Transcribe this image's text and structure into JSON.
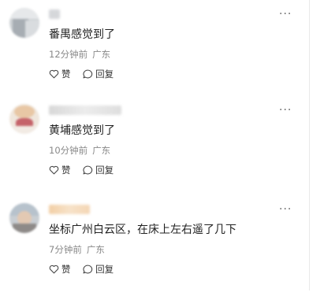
{
  "comments": [
    {
      "text": "番禺感觉到了",
      "time": "12分钟前",
      "location": "广东",
      "like_label": "赞",
      "reply_label": "回复",
      "more": "···"
    },
    {
      "text": "黄埔感觉到了",
      "time": "10分钟前",
      "location": "广东",
      "like_label": "赞",
      "reply_label": "回复",
      "more": "···"
    },
    {
      "text": "坐标广州白云区，在床上左右遥了几下",
      "time": "7分钟前",
      "location": "广东",
      "like_label": "赞",
      "reply_label": "回复",
      "more": "···"
    }
  ],
  "colors": {
    "text": "#222222",
    "meta": "#888888",
    "divider": "#e9e9e9"
  },
  "icons": [
    "heart-icon",
    "comment-bubble-icon",
    "more-dots-icon"
  ]
}
